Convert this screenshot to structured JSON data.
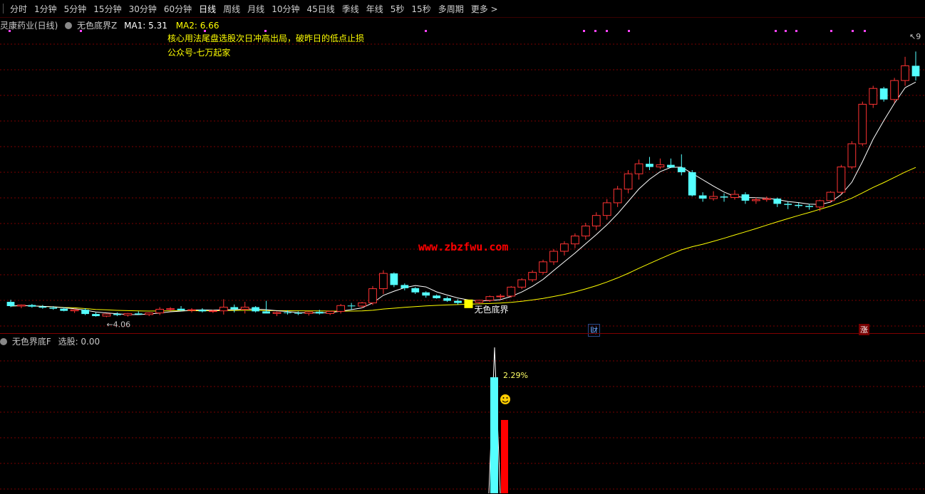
{
  "toolbar": {
    "tabs": [
      "分时",
      "1分钟",
      "5分钟",
      "15分钟",
      "30分钟",
      "60分钟",
      "日线",
      "周线",
      "月线",
      "10分钟",
      "45日线",
      "季线",
      "年线",
      "5秒",
      "15秒",
      "多周期",
      "更多 >"
    ],
    "active_index": 6
  },
  "main_header": {
    "stock_name": "灵康药业(日线)",
    "indicator_name": "无色底界Z",
    "ma1_label": "MA1: 5.31",
    "ma2_label": "MA2: 6.66",
    "ma1_color": "#ffffff",
    "ma2_color": "#ffff00"
  },
  "notes": {
    "line1": "核心用法尾盘选股次日冲高出局，破昨日的低点止损",
    "line2": "公众号-七万起家"
  },
  "watermark": "www.zbzfwu.com",
  "annotations": {
    "low_price": "4.06",
    "signal_label": "无色底界",
    "high_price_marker": "9",
    "tag_cai": "财",
    "tag_zhang": "涨"
  },
  "sub_header": {
    "indicator_name": "无色界底F",
    "value_label": "选股: 0.00",
    "pct_label": "2.29%",
    "smiley_icon": "smiley-face-icon"
  },
  "colors": {
    "up": "#ff3333",
    "down": "#54ffff",
    "grid": "#7a0000",
    "signal": "#ffff00"
  },
  "chart_data": [
    {
      "type": "candlestick",
      "title": "灵康药业(日线)",
      "series": [
        {
          "name": "MA1",
          "ma_values": [
            5.31
          ]
        },
        {
          "name": "MA2",
          "ma_values": [
            6.66
          ]
        }
      ],
      "candles": [
        [
          4.3,
          4.34,
          4.2,
          4.22
        ],
        [
          4.22,
          4.25,
          4.18,
          4.24
        ],
        [
          4.24,
          4.26,
          4.19,
          4.21
        ],
        [
          4.21,
          4.24,
          4.17,
          4.19
        ],
        [
          4.19,
          4.22,
          4.15,
          4.17
        ],
        [
          4.17,
          4.2,
          4.12,
          4.13
        ],
        [
          4.13,
          4.17,
          4.09,
          4.15
        ],
        [
          4.15,
          4.18,
          4.05,
          4.07
        ],
        [
          4.07,
          4.1,
          4.02,
          4.03
        ],
        [
          4.03,
          4.08,
          4.01,
          4.07
        ],
        [
          4.07,
          4.1,
          4.03,
          4.05
        ],
        [
          4.05,
          4.09,
          4.02,
          4.08
        ],
        [
          4.08,
          4.12,
          4.05,
          4.06
        ],
        [
          4.06,
          4.1,
          4.03,
          4.09
        ],
        [
          4.09,
          4.2,
          4.05,
          4.16
        ],
        [
          4.16,
          4.2,
          4.12,
          4.17
        ],
        [
          4.17,
          4.22,
          4.12,
          4.14
        ],
        [
          4.14,
          4.18,
          4.1,
          4.15
        ],
        [
          4.15,
          4.18,
          4.1,
          4.12
        ],
        [
          4.12,
          4.15,
          4.09,
          4.13
        ],
        [
          4.13,
          4.35,
          4.06,
          4.2
        ],
        [
          4.2,
          4.25,
          4.1,
          4.16
        ],
        [
          4.16,
          4.3,
          4.08,
          4.2
        ],
        [
          4.2,
          4.22,
          4.1,
          4.12
        ],
        [
          4.12,
          4.32,
          4.08,
          4.08
        ],
        [
          4.08,
          4.12,
          4.03,
          4.1
        ],
        [
          4.1,
          4.14,
          4.06,
          4.09
        ],
        [
          4.09,
          4.12,
          4.05,
          4.08
        ],
        [
          4.08,
          4.12,
          4.04,
          4.11
        ],
        [
          4.11,
          4.15,
          4.06,
          4.08
        ],
        [
          4.08,
          4.13,
          4.05,
          4.12
        ],
        [
          4.12,
          4.26,
          4.08,
          4.23
        ],
        [
          4.23,
          4.28,
          4.15,
          4.22
        ],
        [
          4.22,
          4.3,
          4.18,
          4.28
        ],
        [
          4.28,
          4.6,
          4.24,
          4.55
        ],
        [
          4.55,
          4.9,
          4.45,
          4.84
        ],
        [
          4.84,
          4.86,
          4.58,
          4.62
        ],
        [
          4.62,
          4.65,
          4.52,
          4.56
        ],
        [
          4.56,
          4.58,
          4.45,
          4.48
        ],
        [
          4.48,
          4.5,
          4.38,
          4.42
        ],
        [
          4.42,
          4.44,
          4.36,
          4.37
        ],
        [
          4.37,
          4.4,
          4.3,
          4.32
        ],
        [
          4.32,
          4.35,
          4.25,
          4.28
        ],
        [
          4.28,
          4.31,
          4.24,
          4.29
        ],
        [
          4.29,
          4.34,
          4.26,
          4.33
        ],
        [
          4.33,
          4.42,
          4.3,
          4.4
        ],
        [
          4.4,
          4.45,
          4.35,
          4.41
        ],
        [
          4.41,
          4.6,
          4.38,
          4.58
        ],
        [
          4.58,
          4.75,
          4.54,
          4.72
        ],
        [
          4.72,
          4.9,
          4.68,
          4.86
        ],
        [
          4.86,
          5.1,
          4.82,
          5.06
        ],
        [
          5.06,
          5.3,
          5.0,
          5.26
        ],
        [
          5.26,
          5.45,
          5.18,
          5.4
        ],
        [
          5.4,
          5.6,
          5.32,
          5.55
        ],
        [
          5.55,
          5.8,
          5.48,
          5.74
        ],
        [
          5.74,
          6.0,
          5.66,
          5.94
        ],
        [
          5.94,
          6.25,
          5.86,
          6.18
        ],
        [
          6.18,
          6.5,
          6.1,
          6.44
        ],
        [
          6.44,
          6.8,
          6.36,
          6.73
        ],
        [
          6.73,
          7.0,
          6.62,
          6.92
        ],
        [
          6.92,
          7.05,
          6.8,
          6.86
        ],
        [
          6.86,
          7.02,
          6.82,
          6.9
        ],
        [
          6.9,
          7.02,
          6.84,
          6.85
        ],
        [
          6.85,
          7.1,
          6.7,
          6.76
        ],
        [
          6.76,
          6.8,
          6.3,
          6.32
        ],
        [
          6.32,
          6.38,
          6.2,
          6.26
        ],
        [
          6.26,
          6.4,
          6.22,
          6.3
        ],
        [
          6.3,
          6.36,
          6.2,
          6.28
        ],
        [
          6.28,
          6.42,
          6.24,
          6.34
        ],
        [
          6.34,
          6.38,
          6.16,
          6.22
        ],
        [
          6.22,
          6.28,
          6.16,
          6.24
        ],
        [
          6.24,
          6.3,
          6.2,
          6.26
        ],
        [
          6.26,
          6.28,
          6.1,
          6.16
        ],
        [
          6.16,
          6.2,
          6.06,
          6.14
        ],
        [
          6.14,
          6.18,
          6.08,
          6.12
        ],
        [
          6.12,
          6.16,
          6.05,
          6.1
        ],
        [
          6.1,
          6.24,
          6.02,
          6.22
        ],
        [
          6.22,
          6.4,
          6.18,
          6.38
        ],
        [
          6.38,
          6.9,
          6.34,
          6.86
        ],
        [
          6.86,
          7.35,
          6.82,
          7.3
        ],
        [
          7.3,
          8.1,
          7.26,
          8.05
        ],
        [
          8.05,
          8.4,
          7.98,
          8.35
        ],
        [
          8.35,
          8.38,
          8.1,
          8.14
        ],
        [
          8.14,
          8.55,
          8.08,
          8.5
        ],
        [
          8.5,
          8.95,
          8.4,
          8.78
        ],
        [
          8.78,
          9.05,
          8.5,
          8.58
        ]
      ]
    },
    {
      "type": "bar",
      "title": "无色界底F",
      "pct_label": "2.29%",
      "series": [
        {
          "name": "选股",
          "values": [
            0.0
          ]
        }
      ]
    }
  ]
}
